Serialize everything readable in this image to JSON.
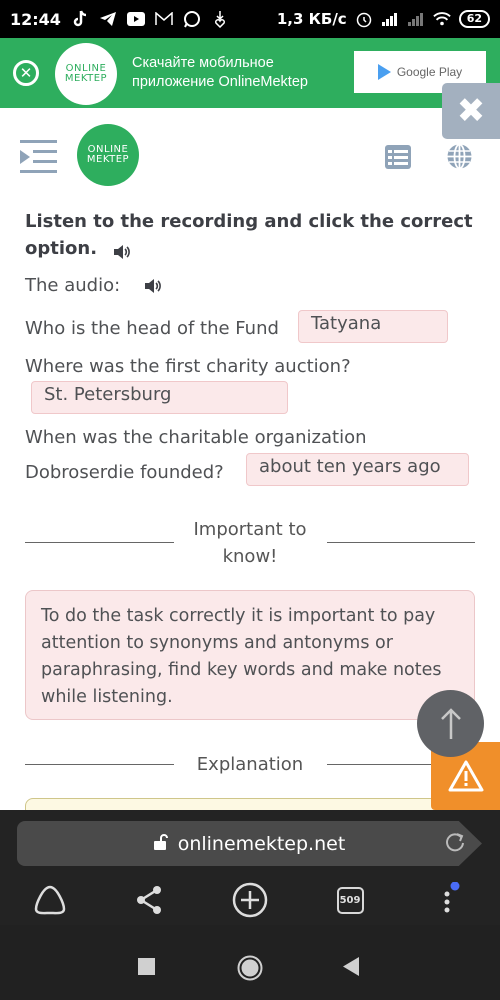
{
  "status_bar": {
    "time": "12:44",
    "app_icons": [
      "tiktok-icon",
      "telegram-icon",
      "youtube-icon",
      "gmail-icon",
      "whatsapp-icon",
      "download-icon"
    ],
    "network_speed": "1,3 КБ/с",
    "battery": "62"
  },
  "promo": {
    "logo_line1": "ONLINE",
    "logo_line2": "MEKTEP",
    "text_line1": "Скачайте мобильное",
    "text_line2": "приложение OnlineMektep",
    "store_label": "Google Play"
  },
  "header": {
    "logo_line1": "ONLINE",
    "logo_line2": "MEKTEP"
  },
  "task": {
    "title": "Listen to the recording and click the correct option.",
    "audio_label": "The audio:",
    "questions": [
      {
        "text": "Who is the head of the Fund",
        "answer": "Tatyana"
      },
      {
        "text": "Where was the first charity auction?",
        "answer": "St. Petersburg"
      },
      {
        "text_line1": "When was the charitable organization",
        "text_line2": "Dobroserdie founded?",
        "answer": "about ten years ago"
      }
    ]
  },
  "important": {
    "label_line1": "Important to",
    "label_line2": "know!",
    "note": "To do the task correctly it is important to pay attention to synonyms and antonyms or paraphrasing, find key words and make notes while listening."
  },
  "explanation": {
    "label": "Explanation"
  },
  "browser": {
    "url": "onlinemektep.net",
    "tab_count": "509"
  },
  "colors": {
    "brand_green": "#2eae5e",
    "answer_bg": "#fbe9ea",
    "report_orange": "#f08f2a",
    "icon_gray": "#8fa3b8"
  }
}
